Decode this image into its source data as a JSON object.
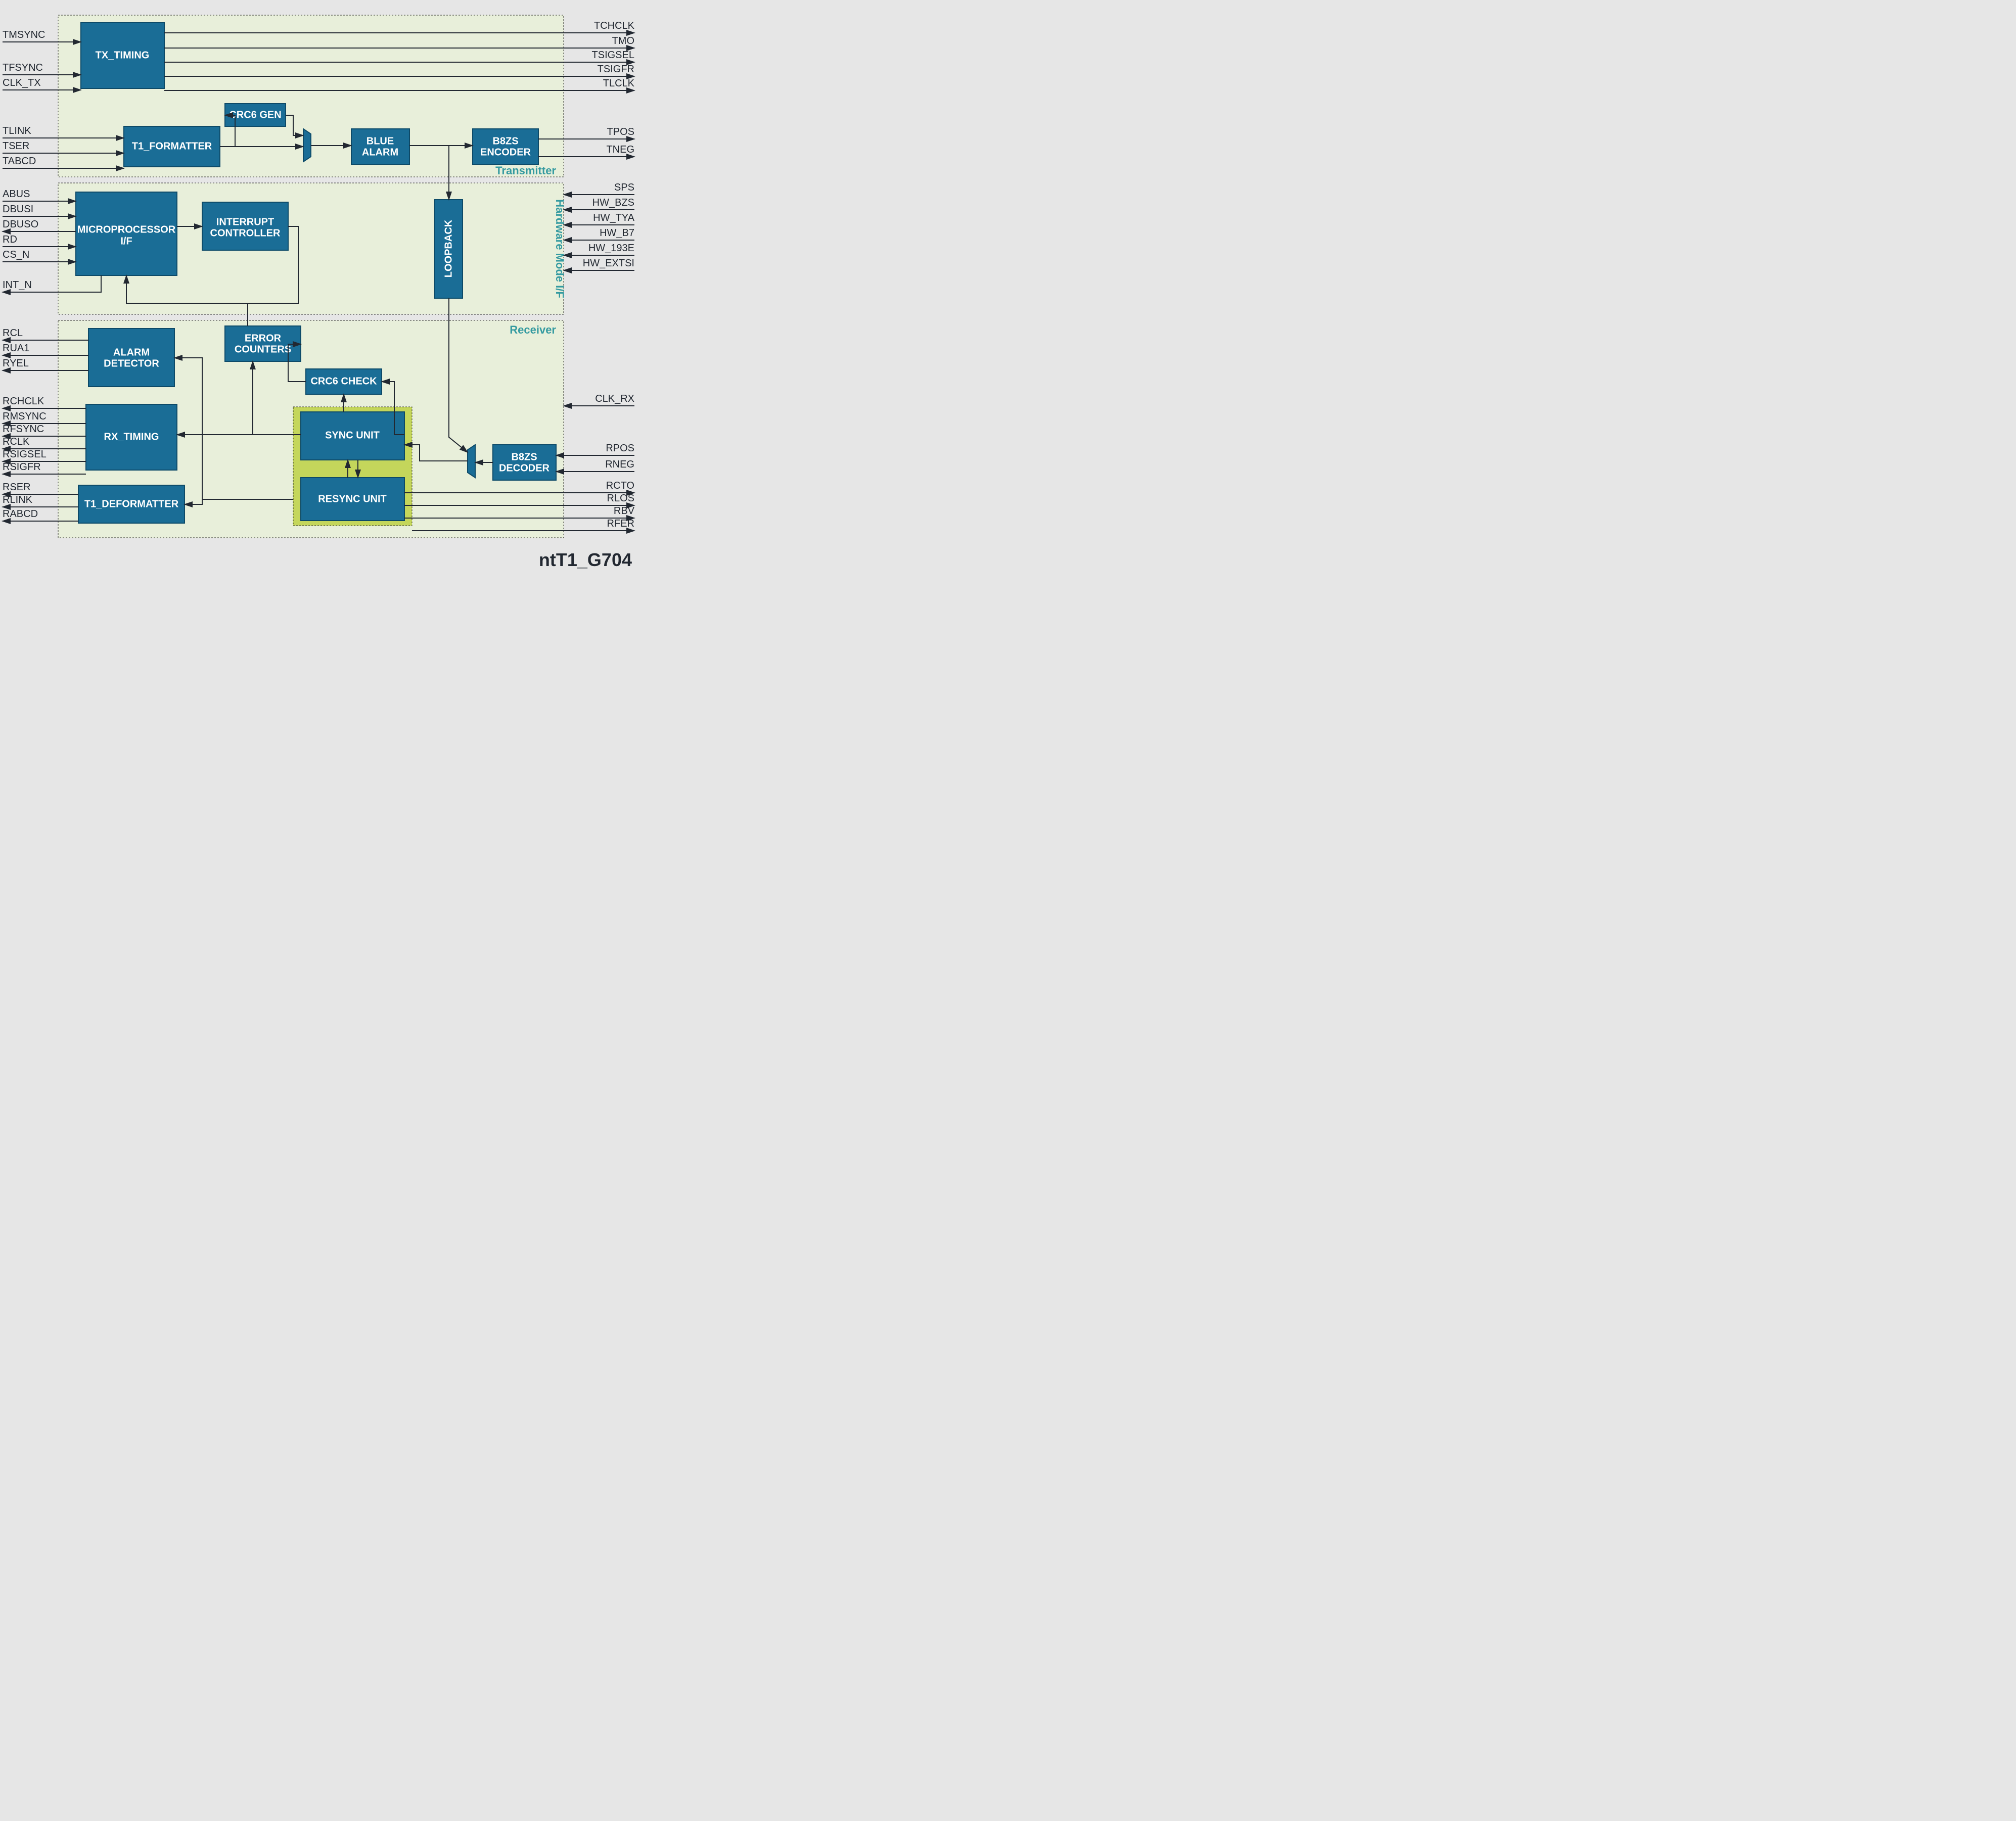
{
  "title": "ntT1_G704",
  "panels": {
    "transmitter": "Transmitter",
    "hwmode": "Hardware Mode I/F",
    "receiver": "Receiver"
  },
  "blocks": {
    "tx_timing": "TX_TIMING",
    "t1_formatter": "T1_FORMATTER",
    "crc6_gen": "CRC6 GEN",
    "blue_alarm1": "BLUE",
    "blue_alarm2": "ALARM",
    "b8zs_enc1": "B8ZS",
    "b8zs_enc2": "ENCODER",
    "micro1": "MICROPROCESSOR",
    "micro2": "I/F",
    "intctrl1": "INTERRUPT",
    "intctrl2": "CONTROLLER",
    "loopback": "LOOPBACK",
    "errcnt1": "ERROR",
    "errcnt2": "COUNTERS",
    "alarm1": "ALARM",
    "alarm2": "DETECTOR",
    "crc6_check": "CRC6 CHECK",
    "rx_timing": "RX_TIMING",
    "sync_unit": "SYNC UNIT",
    "resync_unit": "RESYNC UNIT",
    "b8zs_dec1": "B8ZS",
    "b8zs_dec2": "DECODER",
    "t1_deformatter": "T1_DEFORMATTER"
  },
  "signals_left": {
    "tmsync": "TMSYNC",
    "tfsync": "TFSYNC",
    "clk_tx": "CLK_TX",
    "tlink": "TLINK",
    "tser": "TSER",
    "tabcd": "TABCD",
    "abus": "ABUS",
    "dbusi": "DBUSI",
    "dbuso": "DBUSO",
    "rd": "RD",
    "cs_n": "CS_N",
    "int_n": "INT_N",
    "rcl": "RCL",
    "rua1": "RUA1",
    "ryel": "RYEL",
    "rchclk": "RCHCLK",
    "rmsync": "RMSYNC",
    "rfsync": "RFSYNC",
    "rclk": "RCLK",
    "rsigsel": "RSIGSEL",
    "rsigfr": "RSIGFR",
    "rser": "RSER",
    "rlink": "RLINK",
    "rabcd": "RABCD"
  },
  "signals_right": {
    "tchclk": "TCHCLK",
    "tmo": "TMO",
    "tsigsel": "TSIGSEL",
    "tsigfr": "TSIGFR",
    "tlclk": "TLCLK",
    "tpos": "TPOS",
    "tneg": "TNEG",
    "sps": "SPS",
    "hw_bzs": "HW_BZS",
    "hw_tya": "HW_TYA",
    "hw_b7": "HW_B7",
    "hw_193e": "HW_193E",
    "hw_extsi": "HW_EXTSI",
    "clk_rx": "CLK_RX",
    "rpos": "RPOS",
    "rneg": "RNEG",
    "rcto": "RCTO",
    "rlos": "RLOS",
    "rbv": "RBV",
    "rfer": "RFER"
  }
}
